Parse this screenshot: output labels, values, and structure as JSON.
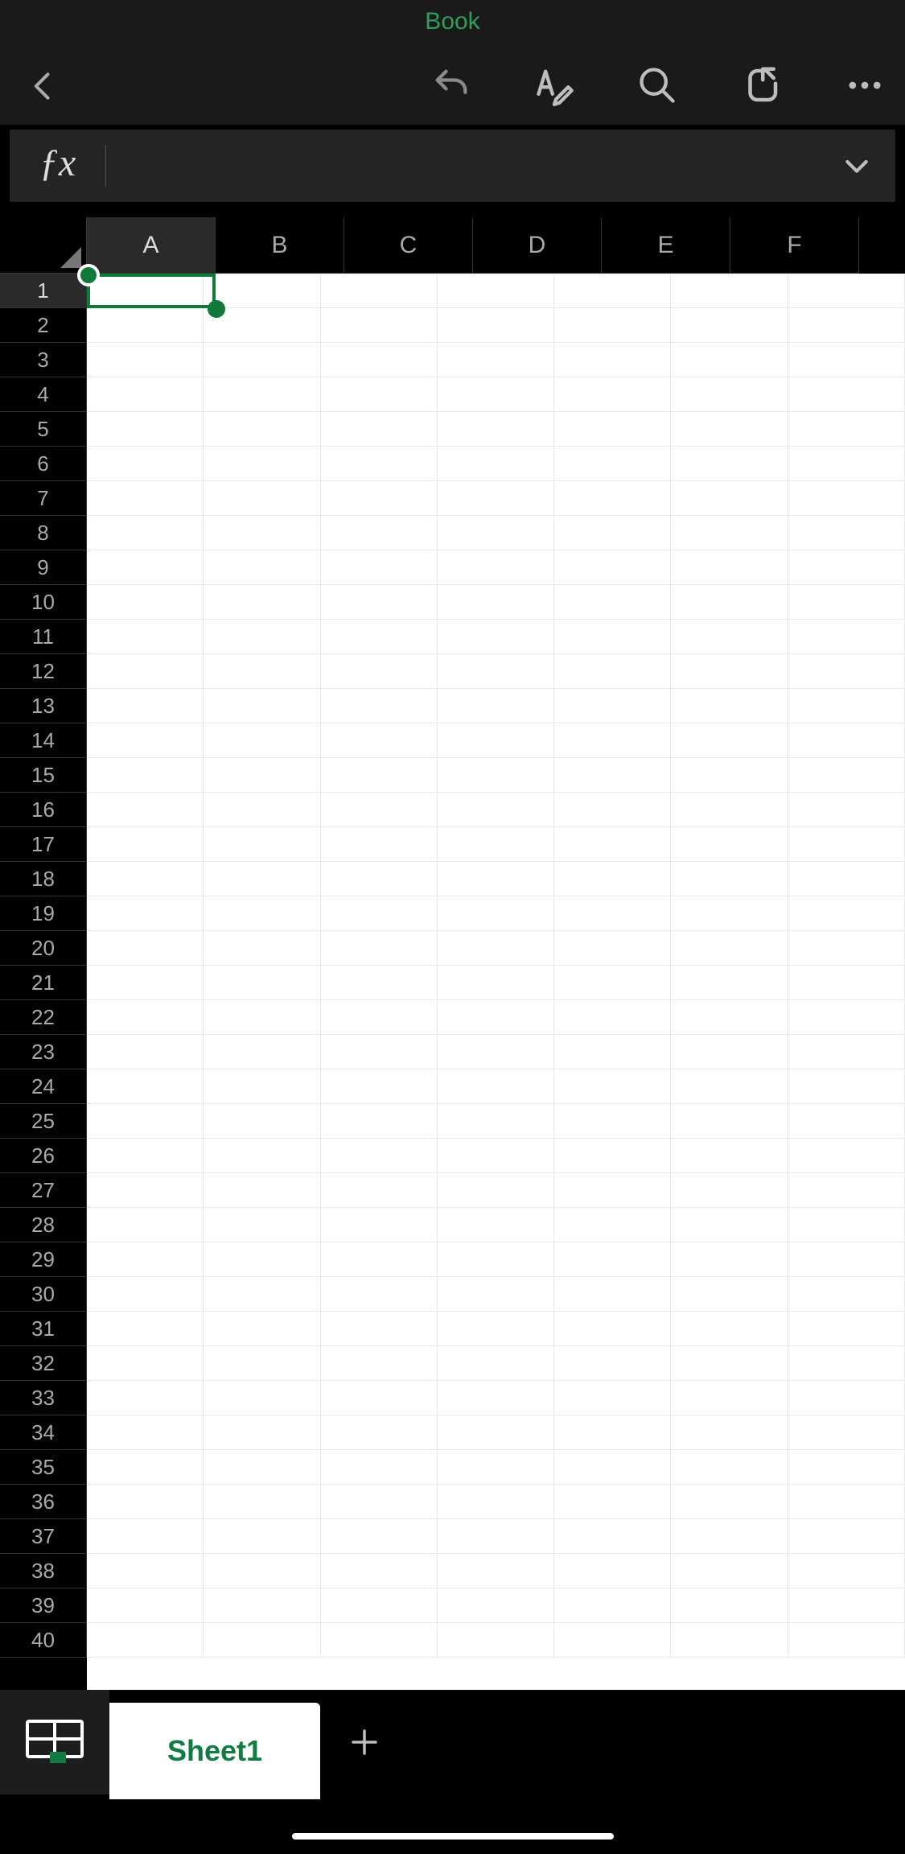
{
  "header": {
    "title": "Book"
  },
  "formula_bar": {
    "value": ""
  },
  "columns": [
    "A",
    "B",
    "C",
    "D",
    "E",
    "F"
  ],
  "rows": [
    "1",
    "2",
    "3",
    "4",
    "5",
    "6",
    "7",
    "8",
    "9",
    "10",
    "11",
    "12",
    "13",
    "14",
    "15",
    "16",
    "17",
    "18",
    "19",
    "20",
    "21",
    "22",
    "23",
    "24",
    "25",
    "26",
    "27",
    "28",
    "29",
    "30",
    "31",
    "32",
    "33",
    "34",
    "35",
    "36",
    "37",
    "38",
    "39",
    "40"
  ],
  "active_cell": {
    "col": "A",
    "row": "1"
  },
  "sheet_tab": {
    "name": "Sheet1"
  }
}
